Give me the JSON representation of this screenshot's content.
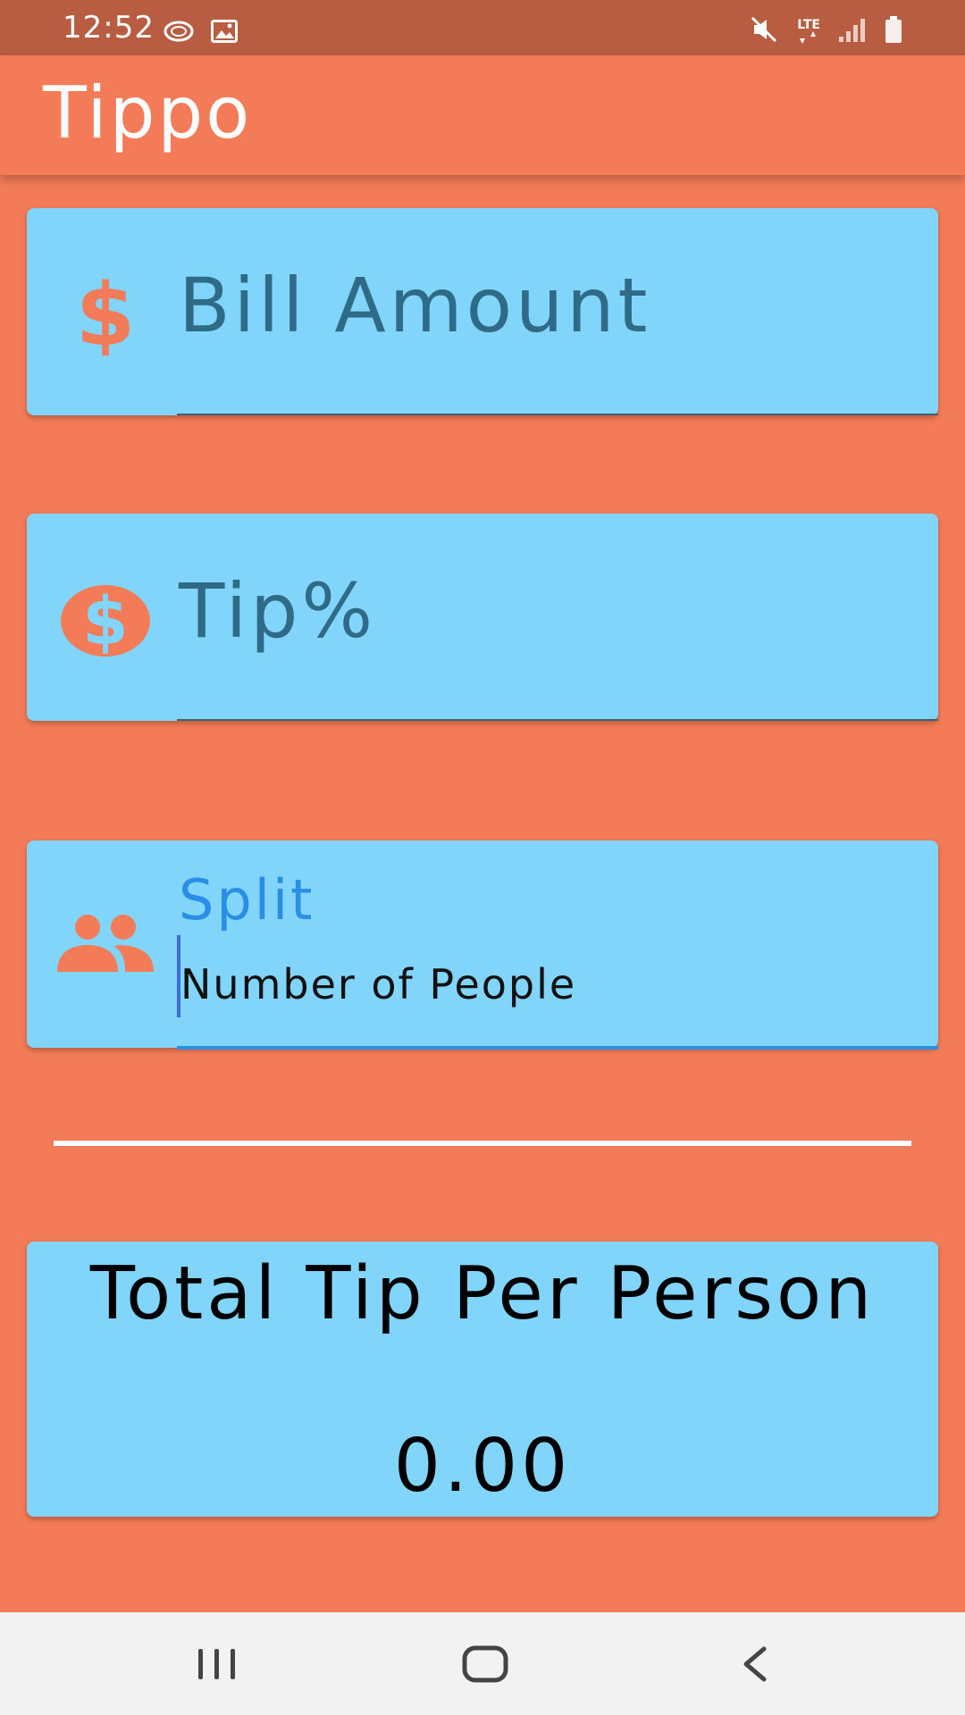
{
  "status_bar": {
    "time": "12:52",
    "network": "LTE"
  },
  "app_bar": {
    "title": "Tippo"
  },
  "bill_field": {
    "placeholder": "Bill Amount",
    "icon": "dollar-icon"
  },
  "tip_field": {
    "placeholder": "Tip%",
    "icon": "dollar-circle-icon"
  },
  "split_field": {
    "label": "Split",
    "placeholder": "Number of People",
    "icon": "people-icon"
  },
  "result": {
    "title": "Total Tip Per Person",
    "value": "0.00"
  },
  "colors": {
    "background": "#F37B57",
    "status_bar": "#B85D41",
    "card": "#81D4FA",
    "accent": "#2A8EE6"
  }
}
